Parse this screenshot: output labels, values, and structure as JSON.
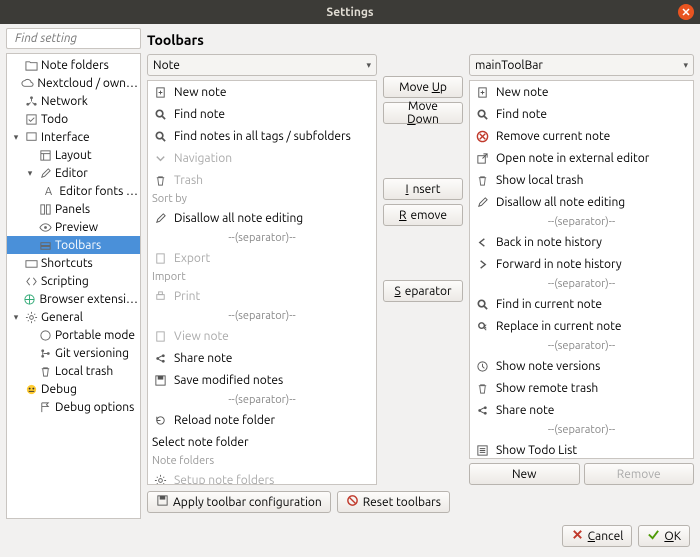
{
  "window": {
    "title": "Settings"
  },
  "search": {
    "placeholder": "Find setting"
  },
  "tree": [
    {
      "label": "Note folders",
      "depth": 0,
      "arrow": "",
      "icon": "folder"
    },
    {
      "label": "Nextcloud / own…",
      "depth": 0,
      "arrow": "",
      "icon": "cloud"
    },
    {
      "label": "Network",
      "depth": 0,
      "arrow": "",
      "icon": "network"
    },
    {
      "label": "Todo",
      "depth": 0,
      "arrow": "",
      "icon": "check"
    },
    {
      "label": "Interface",
      "depth": 0,
      "arrow": "▾",
      "icon": "interface"
    },
    {
      "label": "Layout",
      "depth": 1,
      "arrow": "",
      "icon": "layout"
    },
    {
      "label": "Editor",
      "depth": 1,
      "arrow": "▾",
      "icon": "editor"
    },
    {
      "label": "Editor fonts …",
      "depth": 2,
      "arrow": "",
      "icon": "font"
    },
    {
      "label": "Panels",
      "depth": 1,
      "arrow": "",
      "icon": "panels"
    },
    {
      "label": "Preview",
      "depth": 1,
      "arrow": "",
      "icon": "preview"
    },
    {
      "label": "Toolbars",
      "depth": 1,
      "arrow": "",
      "icon": "toolbar",
      "selected": true
    },
    {
      "label": "Shortcuts",
      "depth": 0,
      "arrow": "",
      "icon": "keyboard"
    },
    {
      "label": "Scripting",
      "depth": 0,
      "arrow": "",
      "icon": "script"
    },
    {
      "label": "Browser extensi…",
      "depth": 0,
      "arrow": "",
      "icon": "globe"
    },
    {
      "label": "General",
      "depth": 0,
      "arrow": "▾",
      "icon": "gear"
    },
    {
      "label": "Portable mode",
      "depth": 1,
      "arrow": "",
      "icon": "usb"
    },
    {
      "label": "Git versioning",
      "depth": 1,
      "arrow": "",
      "icon": "git"
    },
    {
      "label": "Local trash",
      "depth": 1,
      "arrow": "",
      "icon": "trash"
    },
    {
      "label": "Debug",
      "depth": 0,
      "arrow": "",
      "icon": "debug"
    },
    {
      "label": "Debug options",
      "depth": 1,
      "arrow": "",
      "icon": "flag"
    }
  ],
  "heading": "Toolbars",
  "left_combo": "Note",
  "right_combo": "mainToolBar",
  "left_items": [
    {
      "label": "New note",
      "icon": "newnote"
    },
    {
      "label": "Find note",
      "icon": "find"
    },
    {
      "label": "Find notes in all tags / subfolders",
      "icon": "find"
    },
    {
      "label": "Navigation",
      "icon": "chev-down",
      "disabled": true
    },
    {
      "label": "Trash",
      "icon": "trash",
      "disabled": true
    },
    {
      "label": "Sort by",
      "heading": true
    },
    {
      "label": "Disallow all note editing",
      "icon": "pencil"
    },
    {
      "label": "--(separator)--",
      "sep": true
    },
    {
      "label": "Export",
      "icon": "export",
      "disabled": true
    },
    {
      "label": "Import",
      "heading": true
    },
    {
      "label": "Print",
      "icon": "print",
      "disabled": true
    },
    {
      "label": "--(separator)--",
      "sep": true
    },
    {
      "label": "View note",
      "icon": "view",
      "disabled": true
    },
    {
      "label": "Share note",
      "icon": "share"
    },
    {
      "label": "Save modified notes",
      "icon": "save"
    },
    {
      "label": "--(separator)--",
      "sep": true
    },
    {
      "label": "Reload note folder",
      "icon": "reload"
    },
    {
      "label": "Select note folder",
      "plain": true
    },
    {
      "label": "Note folders",
      "heading": true
    },
    {
      "label": "Setup note folders",
      "icon": "gear",
      "disabled": true
    }
  ],
  "right_items": [
    {
      "label": "New note",
      "icon": "newnote"
    },
    {
      "label": "Find note",
      "icon": "find"
    },
    {
      "label": "Remove current note",
      "icon": "remove"
    },
    {
      "label": "Open note in external editor",
      "icon": "external"
    },
    {
      "label": "Show local trash",
      "icon": "trash"
    },
    {
      "label": "Disallow all note editing",
      "icon": "pencil"
    },
    {
      "label": "--(separator)--",
      "sep": true
    },
    {
      "label": "Back in note history",
      "icon": "back"
    },
    {
      "label": "Forward in note history",
      "icon": "forward"
    },
    {
      "label": "--(separator)--",
      "sep": true
    },
    {
      "label": "Find in current note",
      "icon": "find"
    },
    {
      "label": "Replace in current note",
      "icon": "replace"
    },
    {
      "label": "--(separator)--",
      "sep": true
    },
    {
      "label": "Show note versions",
      "icon": "versions"
    },
    {
      "label": "Show remote trash",
      "icon": "trash"
    },
    {
      "label": "Share note",
      "icon": "share"
    },
    {
      "label": "--(separator)--",
      "sep": true
    },
    {
      "label": "Show Todo List",
      "icon": "todo"
    }
  ],
  "buttons": {
    "move_up": "Move Up",
    "move_down": "Move Down",
    "insert": "Insert",
    "remove": "Remove",
    "separator": "Separator",
    "new": "New",
    "remove2": "Remove",
    "apply": "Apply toolbar configuration",
    "reset": "Reset toolbars",
    "cancel": "Cancel",
    "ok": "OK"
  }
}
